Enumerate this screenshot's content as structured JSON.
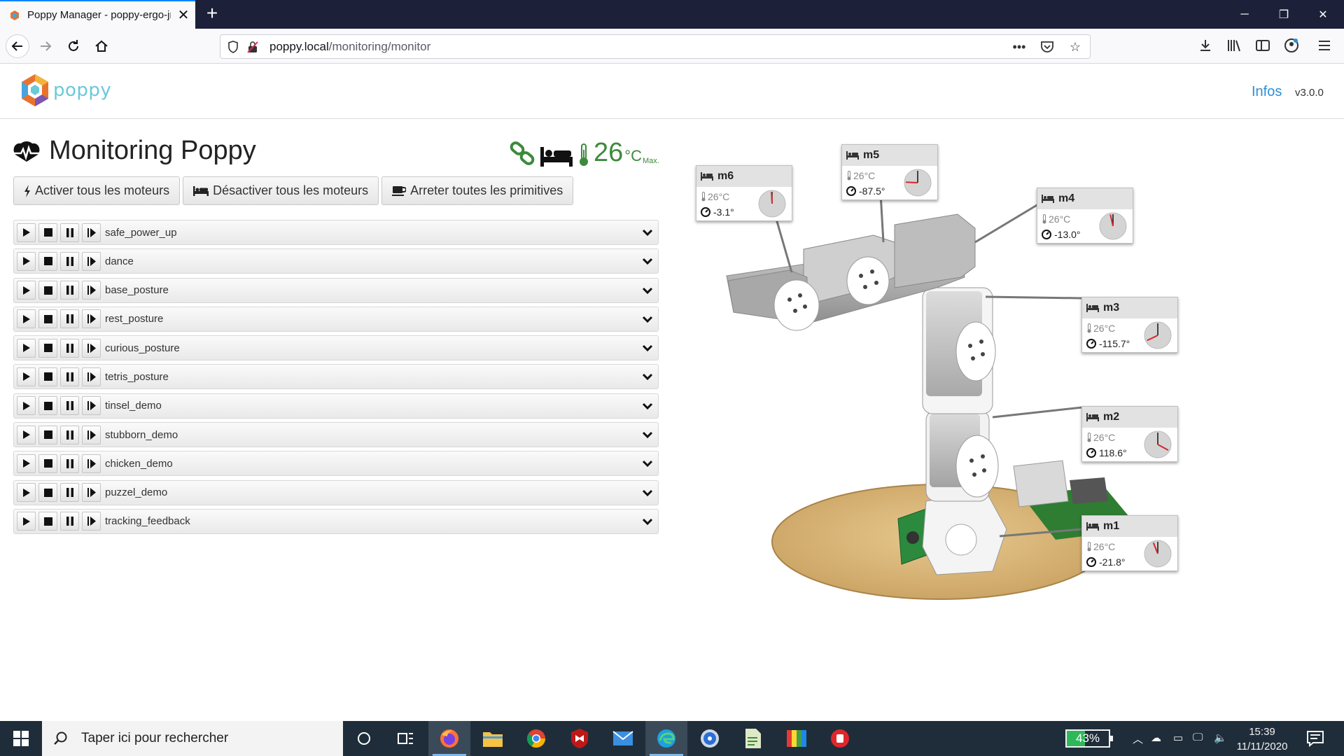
{
  "browser": {
    "tab_title": "Poppy Manager - poppy-ergo-jr",
    "url_host": "poppy.local",
    "url_path": "/monitoring/monitor"
  },
  "header": {
    "logo_text": "poppy",
    "infos_link": "Infos",
    "version": "v3.0.0"
  },
  "page": {
    "title": "Monitoring Poppy",
    "max_temperature": "26",
    "temperature_unit": "°C",
    "temperature_caption": "Max."
  },
  "actions": {
    "activate_all": "Activer tous les moteurs",
    "deactivate_all": "Désactiver tous les moteurs",
    "stop_primitives": "Arreter toutes les primitives"
  },
  "primitives": [
    "safe_power_up",
    "dance",
    "base_posture",
    "rest_posture",
    "curious_posture",
    "tetris_posture",
    "tinsel_demo",
    "stubborn_demo",
    "chicken_demo",
    "puzzel_demo",
    "tracking_feedback"
  ],
  "motors": [
    {
      "name": "m6",
      "temperature": "26°C",
      "position": "-3.1°",
      "angle": -3.1
    },
    {
      "name": "m5",
      "temperature": "26°C",
      "position": "-87.5°",
      "angle": -87.5
    },
    {
      "name": "m4",
      "temperature": "26°C",
      "position": "-13.0°",
      "angle": -13.0
    },
    {
      "name": "m3",
      "temperature": "26°C",
      "position": "-115.7°",
      "angle": -115.7
    },
    {
      "name": "m2",
      "temperature": "26°C",
      "position": "118.6°",
      "angle": 118.6
    },
    {
      "name": "m1",
      "temperature": "26°C",
      "position": "-21.8°",
      "angle": -21.8
    }
  ],
  "taskbar": {
    "search_placeholder": "Taper ici pour rechercher",
    "battery": "43%",
    "battery_level": 0.43,
    "time": "15:39",
    "date": "11/11/2020"
  },
  "colors": {
    "accent_blue": "#2a8fd8",
    "status_green": "#3c8a3c",
    "dial_needle": "#d9262c",
    "logo_teal": "#6cc9d8"
  }
}
